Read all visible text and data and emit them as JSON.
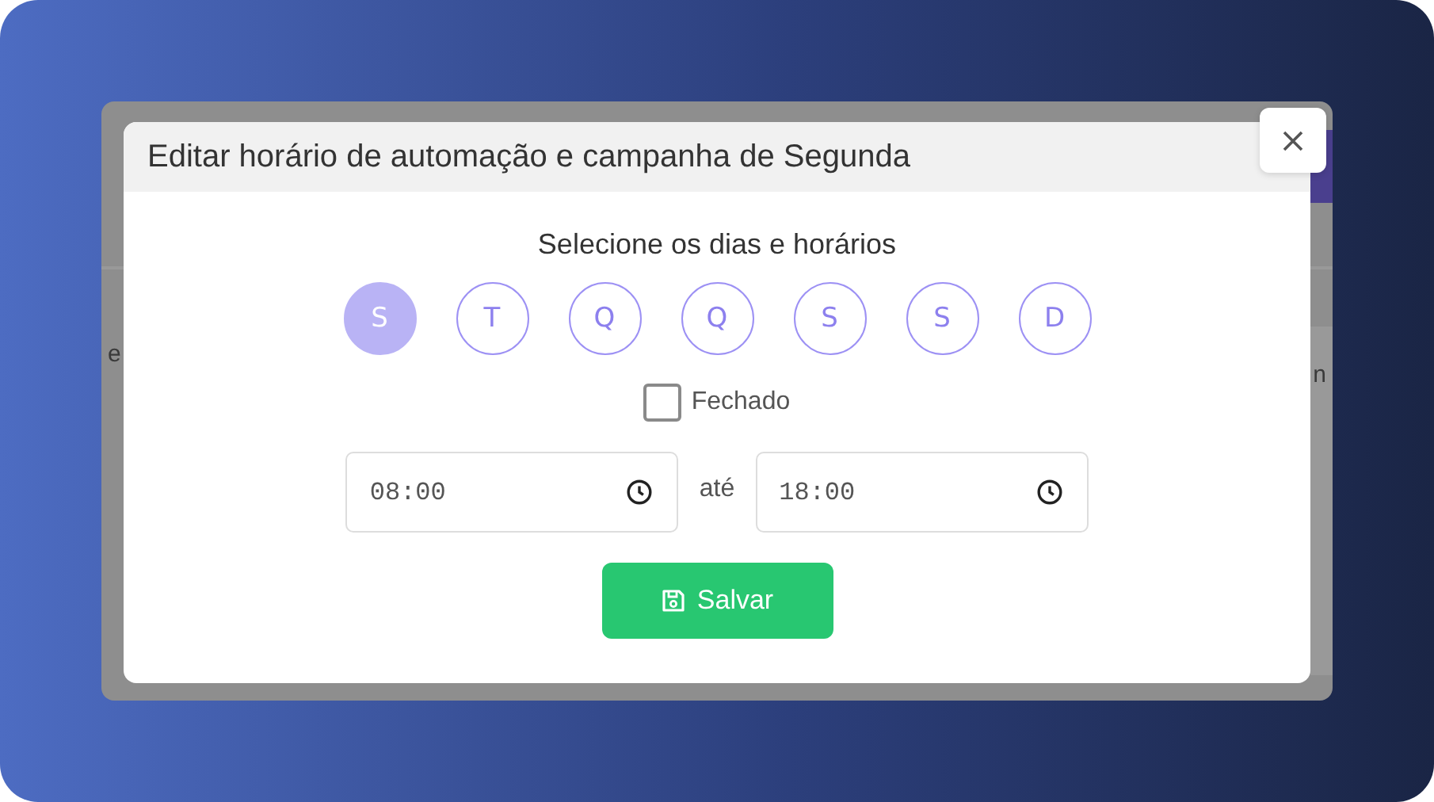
{
  "background_texts": [
    "e",
    "n"
  ],
  "dialog": {
    "title": "Editar horário de automação e campanha de Segunda",
    "subtitle": "Selecione os dias e horários",
    "days": [
      {
        "label": "S",
        "selected": true
      },
      {
        "label": "T",
        "selected": false
      },
      {
        "label": "Q",
        "selected": false
      },
      {
        "label": "Q",
        "selected": false
      },
      {
        "label": "S",
        "selected": false
      },
      {
        "label": "S",
        "selected": false
      },
      {
        "label": "D",
        "selected": false
      }
    ],
    "closed": {
      "label": "Fechado",
      "checked": false
    },
    "start_time": "08:00",
    "separator": "até",
    "end_time": "18:00",
    "save_button": "Salvar"
  }
}
